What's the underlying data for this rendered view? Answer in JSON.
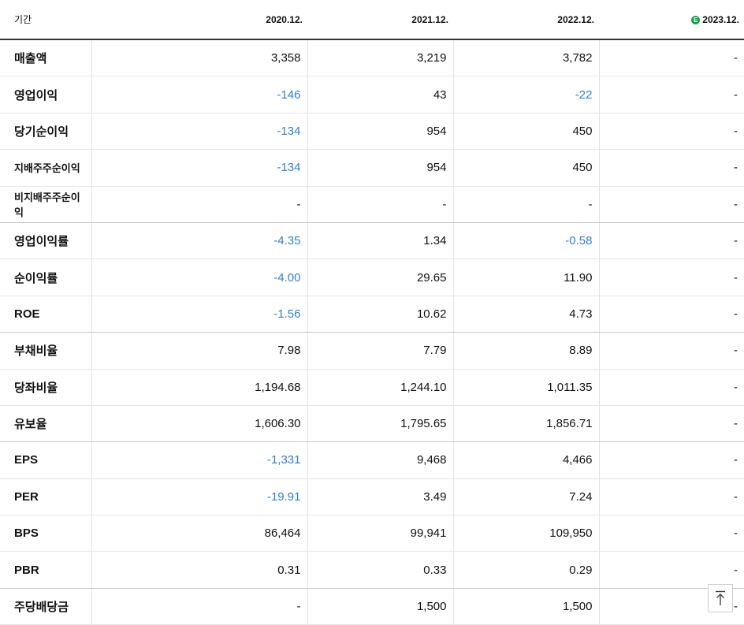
{
  "header": {
    "period_label": "기간",
    "periods": [
      "2020.12.",
      "2021.12.",
      "2022.12.",
      "2023.12."
    ],
    "estimate_icon": "e-estimate-icon",
    "estimate_icon_glyph": "E"
  },
  "rows": [
    {
      "name": "매출액",
      "values": [
        "3,358",
        "3,219",
        "3,782",
        "-"
      ]
    },
    {
      "name": "영업이익",
      "values": [
        "-146",
        "43",
        "-22",
        "-"
      ]
    },
    {
      "name": "당기순이익",
      "values": [
        "-134",
        "954",
        "450",
        "-"
      ]
    },
    {
      "name": "지배주주순이익",
      "values": [
        "-134",
        "954",
        "450",
        "-"
      ]
    },
    {
      "name": "비지배주주순이익",
      "values": [
        "-",
        "-",
        "-",
        "-"
      ]
    },
    {
      "name": "영업이익률",
      "values": [
        "-4.35",
        "1.34",
        "-0.58",
        "-"
      ]
    },
    {
      "name": "순이익률",
      "values": [
        "-4.00",
        "29.65",
        "11.90",
        "-"
      ]
    },
    {
      "name": "ROE",
      "values": [
        "-1.56",
        "10.62",
        "4.73",
        "-"
      ]
    },
    {
      "name": "부채비율",
      "values": [
        "7.98",
        "7.79",
        "8.89",
        "-"
      ]
    },
    {
      "name": "당좌비율",
      "values": [
        "1,194.68",
        "1,244.10",
        "1,011.35",
        "-"
      ]
    },
    {
      "name": "유보율",
      "values": [
        "1,606.30",
        "1,795.65",
        "1,856.71",
        "-"
      ]
    },
    {
      "name": "EPS",
      "values": [
        "-1,331",
        "9,468",
        "4,466",
        "-"
      ]
    },
    {
      "name": "PER",
      "values": [
        "-19.91",
        "3.49",
        "7.24",
        "-"
      ]
    },
    {
      "name": "BPS",
      "values": [
        "86,464",
        "99,941",
        "109,950",
        "-"
      ]
    },
    {
      "name": "PBR",
      "values": [
        "0.31",
        "0.33",
        "0.29",
        "-"
      ]
    },
    {
      "name": "주당배당금",
      "values": [
        "-",
        "1,500",
        "1,500",
        "-"
      ]
    }
  ],
  "colors": {
    "negative": "#2f7fd8",
    "estimate": "#17a34a"
  },
  "scroll_top": {
    "icon": "arrow-up-to-top-icon"
  }
}
